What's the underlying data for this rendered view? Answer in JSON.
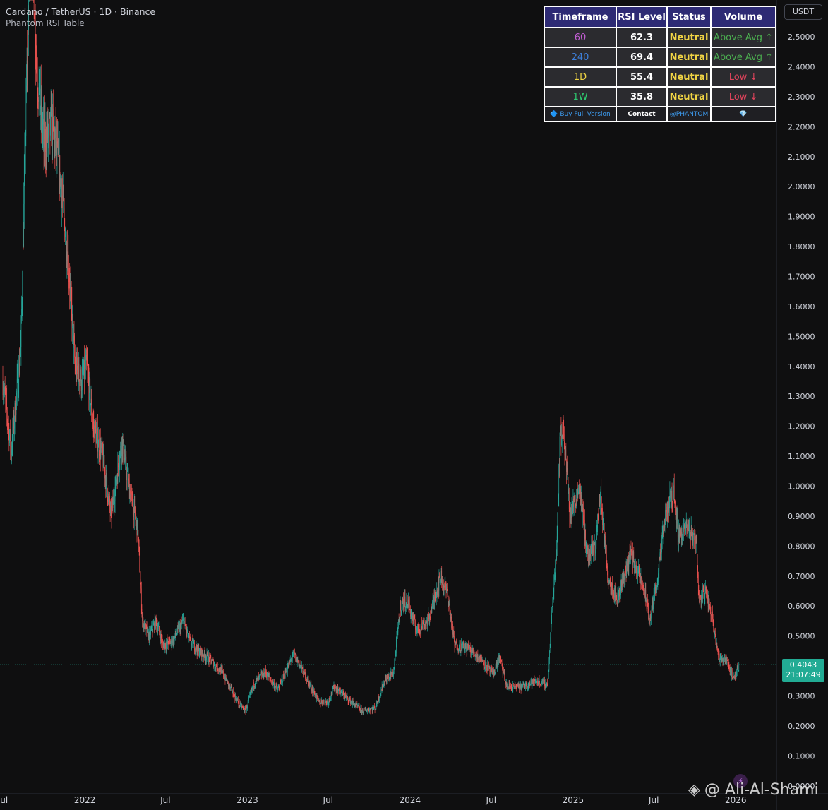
{
  "header": {
    "symbol_line": "Cardano / TetherUS · 1D · Binance",
    "indicator": "Phantom RSI Table"
  },
  "currency_button": "USDT",
  "rsi_table": {
    "headers": [
      "Timeframe",
      "RSI Level",
      "Status",
      "Volume"
    ],
    "rows": [
      {
        "timeframe": "60",
        "tf_color": "#c45fd6",
        "rsi": "62.3",
        "status": "Neutral",
        "volume": "Above Avg ↑",
        "vol_color": "#4caf50"
      },
      {
        "timeframe": "240",
        "tf_color": "#3d7fd9",
        "rsi": "69.4",
        "status": "Neutral",
        "volume": "Above Avg ↑",
        "vol_color": "#4caf50"
      },
      {
        "timeframe": "1D",
        "tf_color": "#f0d444",
        "rsi": "55.4",
        "status": "Neutral",
        "volume": "Low ↓",
        "vol_color": "#e0445c"
      },
      {
        "timeframe": "1W",
        "tf_color": "#2ecc71",
        "rsi": "35.8",
        "status": "Neutral",
        "volume": "Low ↓",
        "vol_color": "#e0445c"
      }
    ],
    "footer": {
      "buy": "🔷 Buy Full Version",
      "contact": "Contact",
      "handle": "@PHANTOM",
      "gem": "💎"
    }
  },
  "price_label": {
    "price": "0.4043",
    "countdown": "21:07:49"
  },
  "watermark": "@ Ali-Al-Shami",
  "colors": {
    "up": "#26a69a",
    "down": "#ef5350",
    "background": "#0f0f10",
    "last_price": "#22ab94"
  },
  "chart_data": {
    "type": "candlestick",
    "title": "Cardano / TetherUS · 1D · Binance",
    "y_unit": "USDT",
    "ylim": [
      0.0,
      2.6
    ],
    "y_ticks": [
      "2.5000",
      "2.4000",
      "2.3000",
      "2.2000",
      "2.1000",
      "2.0000",
      "1.9000",
      "1.8000",
      "1.7000",
      "1.6000",
      "1.5000",
      "1.4000",
      "1.3000",
      "1.2000",
      "1.1000",
      "1.0000",
      "0.9000",
      "0.8000",
      "0.7000",
      "0.6000",
      "0.5000",
      "0.4000",
      "0.3000",
      "0.2000",
      "0.1000",
      "0.0000"
    ],
    "x_ticks": [
      "Jul",
      "2022",
      "Jul",
      "2023",
      "Jul",
      "2024",
      "Jul",
      "2025",
      "Jul",
      "2026"
    ],
    "x_tick_dates": [
      "2021-07-01",
      "2022-01-01",
      "2022-07-01",
      "2023-01-01",
      "2023-07-01",
      "2024-01-01",
      "2024-07-01",
      "2025-01-01",
      "2025-07-01",
      "2026-01-01"
    ],
    "x_range": [
      "2021-07-01",
      "2026-01-10"
    ],
    "last_price": 0.4043,
    "series": [
      {
        "name": "ADAUSDT",
        "close_path": [
          [
            "2021-07-01",
            1.35
          ],
          [
            "2021-07-20",
            1.12
          ],
          [
            "2021-08-10",
            1.45
          ],
          [
            "2021-08-25",
            2.45
          ],
          [
            "2021-09-02",
            2.95
          ],
          [
            "2021-09-15",
            2.4
          ],
          [
            "2021-10-01",
            2.15
          ],
          [
            "2021-10-20",
            2.2
          ],
          [
            "2021-11-05",
            2.05
          ],
          [
            "2021-11-25",
            1.75
          ],
          [
            "2021-12-10",
            1.4
          ],
          [
            "2021-12-25",
            1.35
          ],
          [
            "2022-01-05",
            1.4
          ],
          [
            "2022-01-20",
            1.2
          ],
          [
            "2022-02-10",
            1.1
          ],
          [
            "2022-03-01",
            0.9
          ],
          [
            "2022-03-25",
            1.15
          ],
          [
            "2022-04-10",
            1.0
          ],
          [
            "2022-04-30",
            0.85
          ],
          [
            "2022-05-10",
            0.55
          ],
          [
            "2022-05-25",
            0.5
          ],
          [
            "2022-06-10",
            0.55
          ],
          [
            "2022-06-25",
            0.47
          ],
          [
            "2022-07-15",
            0.48
          ],
          [
            "2022-08-10",
            0.55
          ],
          [
            "2022-08-25",
            0.48
          ],
          [
            "2022-09-15",
            0.45
          ],
          [
            "2022-10-10",
            0.42
          ],
          [
            "2022-11-05",
            0.38
          ],
          [
            "2022-11-25",
            0.32
          ],
          [
            "2022-12-15",
            0.27
          ],
          [
            "2022-12-28",
            0.25
          ],
          [
            "2023-01-15",
            0.34
          ],
          [
            "2023-02-10",
            0.38
          ],
          [
            "2023-03-10",
            0.32
          ],
          [
            "2023-04-15",
            0.44
          ],
          [
            "2023-05-10",
            0.37
          ],
          [
            "2023-06-10",
            0.28
          ],
          [
            "2023-07-01",
            0.28
          ],
          [
            "2023-07-15",
            0.33
          ],
          [
            "2023-08-15",
            0.29
          ],
          [
            "2023-09-15",
            0.25
          ],
          [
            "2023-10-15",
            0.26
          ],
          [
            "2023-11-05",
            0.35
          ],
          [
            "2023-11-25",
            0.38
          ],
          [
            "2023-12-10",
            0.6
          ],
          [
            "2023-12-25",
            0.62
          ],
          [
            "2024-01-15",
            0.52
          ],
          [
            "2024-02-10",
            0.55
          ],
          [
            "2024-03-10",
            0.7
          ],
          [
            "2024-03-25",
            0.64
          ],
          [
            "2024-04-10",
            0.47
          ],
          [
            "2024-05-10",
            0.46
          ],
          [
            "2024-06-10",
            0.42
          ],
          [
            "2024-07-05",
            0.37
          ],
          [
            "2024-07-20",
            0.43
          ],
          [
            "2024-08-05",
            0.33
          ],
          [
            "2024-09-05",
            0.33
          ],
          [
            "2024-10-10",
            0.35
          ],
          [
            "2024-11-05",
            0.34
          ],
          [
            "2024-11-15",
            0.6
          ],
          [
            "2024-11-25",
            0.8
          ],
          [
            "2024-12-02",
            1.15
          ],
          [
            "2024-12-10",
            1.2
          ],
          [
            "2024-12-25",
            0.9
          ],
          [
            "2025-01-15",
            1.0
          ],
          [
            "2025-02-03",
            0.76
          ],
          [
            "2025-02-20",
            0.8
          ],
          [
            "2025-03-03",
            0.98
          ],
          [
            "2025-03-20",
            0.7
          ],
          [
            "2025-04-10",
            0.62
          ],
          [
            "2025-05-10",
            0.78
          ],
          [
            "2025-06-10",
            0.65
          ],
          [
            "2025-06-22",
            0.55
          ],
          [
            "2025-07-10",
            0.7
          ],
          [
            "2025-07-25",
            0.88
          ],
          [
            "2025-08-14",
            0.99
          ],
          [
            "2025-08-25",
            0.84
          ],
          [
            "2025-09-15",
            0.86
          ],
          [
            "2025-10-05",
            0.82
          ],
          [
            "2025-10-10",
            0.62
          ],
          [
            "2025-10-25",
            0.65
          ],
          [
            "2025-11-10",
            0.56
          ],
          [
            "2025-11-25",
            0.42
          ],
          [
            "2025-12-10",
            0.43
          ],
          [
            "2025-12-28",
            0.35
          ],
          [
            "2026-01-08",
            0.4043
          ]
        ]
      }
    ]
  }
}
